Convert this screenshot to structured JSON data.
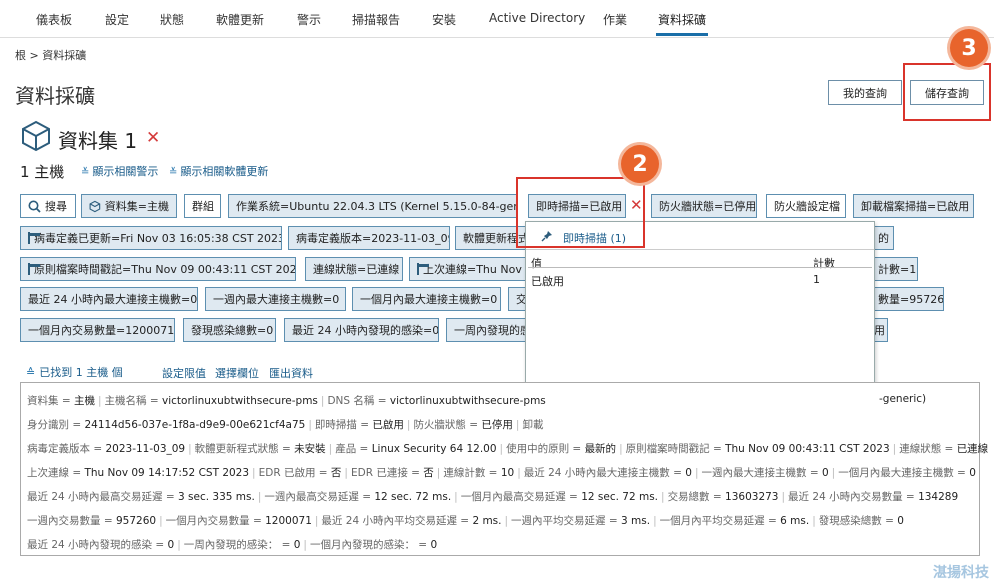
{
  "nav": {
    "items": [
      "儀表板",
      "設定",
      "狀態",
      "軟體更新",
      "警示",
      "掃描報告",
      "安裝",
      "Active Directory",
      "作業",
      "資料採礦"
    ],
    "active": "資料採礦"
  },
  "breadcrumb": "根 > 資料採礦",
  "page_title": "資料採礦",
  "header_buttons": {
    "my_queries": "我的查詢",
    "save_query": "儲存查詢"
  },
  "callouts": {
    "c2": "2",
    "c3": "3"
  },
  "dataset": {
    "title": "資料集 1",
    "close": "✕"
  },
  "hosts": {
    "count": "1 主機",
    "show_alerts": "顯示相關警示",
    "show_updates": "顯示相關軟體更新"
  },
  "chips": {
    "search": "搜尋",
    "dataset_host": "資料集=主機",
    "group": "群組",
    "os": "作業系統=Ubuntu 22.04.3 LTS (Kernel 5.15.0-84-generic)",
    "realtime": "即時掃描=已啟用",
    "realtime_x": "✕",
    "firewall_state": "防火牆狀態=已停用",
    "firewall_profile": "防火牆設定檔",
    "uninstall_scan": "卸載檔案掃描=已啟用",
    "virus_updated": "病毒定義已更新=Fri Nov 03 16:05:38 CST 2023",
    "virus_version": "病毒定義版本=2023-11-03_09",
    "sw_update": "軟體更新程式",
    "row2_tail": "的",
    "policy_time": "原則檔案時間戳記=Thu Nov 09 00:43:11 CST 2023",
    "conn_state": "連線狀態=已連線",
    "last_conn": "上次連線=Thu Nov",
    "conn_count_tail": "計數=10",
    "max24": "最近 24 小時內最大連接主機數=0",
    "maxweek": "一週內最大連接主機數=0",
    "maxmonth": "一個月內最大連接主機數=0",
    "row4_mid": "交",
    "txcount_tail": "數量=957260",
    "month_tx": "一個月內交易數量=1200071",
    "infections": "發現感染總數=0",
    "inf24": "最近 24 小時內發現的感染=0",
    "infweek": "一周內發現的感",
    "row5_tail": "用"
  },
  "popup": {
    "title": "即時掃描 (1)",
    "col_value": "值",
    "col_count": "計數",
    "row_value": "已啟用",
    "row_count": "1"
  },
  "results": {
    "found": "已找到 1 主機 個",
    "set_limit": "設定限值",
    "select_cols": "選擇欄位",
    "export": "匯出資料"
  },
  "details": {
    "r1": [
      [
        "資料集",
        "主機"
      ],
      [
        "主機名稱",
        "victorlinuxubtwithsecure-pms"
      ],
      [
        "DNS 名稱",
        "victorlinuxubtwithsecure-pms"
      ]
    ],
    "r1_tail": "-generic)",
    "r2": [
      [
        "身分識別",
        "24114d56-037e-1f8a-d9e9-00e621cf4a75"
      ],
      [
        "即時掃描",
        "已啟用"
      ],
      [
        "防火牆狀態",
        "已停用"
      ],
      [
        "卸載",
        ""
      ]
    ],
    "r3": [
      [
        "病毒定義版本",
        "2023-11-03_09"
      ],
      [
        "軟體更新程式狀態",
        "未安裝"
      ],
      [
        "產品",
        "Linux Security 64 12.00"
      ],
      [
        "使用中的原則",
        "最新的"
      ],
      [
        "原則檔案時間戳記",
        "Thu Nov 09 00:43:11 CST 2023"
      ],
      [
        "連線狀態",
        "已連線"
      ]
    ],
    "r4": [
      [
        "上次連線",
        "Thu Nov 09 14:17:52 CST 2023"
      ],
      [
        "EDR 已啟用",
        "否"
      ],
      [
        "EDR 已連接",
        "否"
      ],
      [
        "連線計數",
        "10"
      ],
      [
        "最近 24 小時內最大連接主機數",
        "0"
      ],
      [
        "一週內最大連接主機數",
        "0"
      ],
      [
        "一個月內最大連接主機數",
        "0"
      ]
    ],
    "r5": [
      [
        "最近 24 小時內最高交易延遲",
        "3 sec. 335 ms."
      ],
      [
        "一週內最高交易延遲",
        "12 sec. 72 ms."
      ],
      [
        "一個月內最高交易延遲",
        "12 sec. 72 ms."
      ],
      [
        "交易總數",
        "13603273"
      ],
      [
        "最近 24 小時內交易數量",
        "134289"
      ]
    ],
    "r6": [
      [
        "一週內交易數量",
        "957260"
      ],
      [
        "一個月內交易數量",
        "1200071"
      ],
      [
        "最近 24 小時內平均交易延遲",
        "2 ms."
      ],
      [
        "一週內平均交易延遲",
        "3 ms."
      ],
      [
        "一個月內平均交易延遲",
        "6 ms."
      ],
      [
        "發現感染總數",
        "0"
      ]
    ],
    "r7": [
      [
        "最近 24 小時內發現的感染",
        "0"
      ],
      [
        "一周內發現的感染：",
        "0"
      ],
      [
        "一個月內發現的感染：",
        "0"
      ]
    ]
  },
  "watermark": "湛揚科技"
}
